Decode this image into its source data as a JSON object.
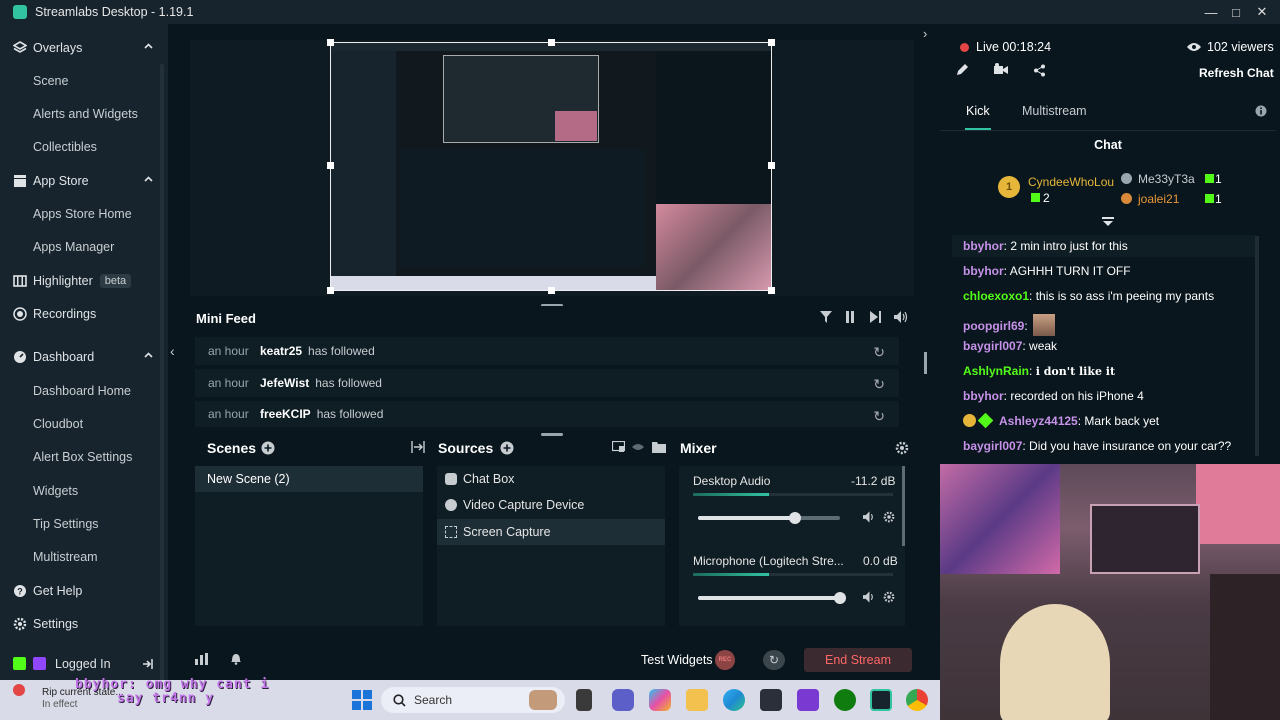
{
  "window": {
    "title": "Streamlabs Desktop - 1.19.1"
  },
  "sidebar": {
    "overlays": "Overlays",
    "scene": "Scene",
    "alerts_widgets": "Alerts and Widgets",
    "collectibles": "Collectibles",
    "app_store": "App Store",
    "apps_store_home": "Apps Store Home",
    "apps_manager": "Apps Manager",
    "highlighter": "Highlighter",
    "highlighter_badge": "beta",
    "recordings": "Recordings",
    "dashboard": "Dashboard",
    "dashboard_home": "Dashboard Home",
    "cloudbot": "Cloudbot",
    "alert_box_settings": "Alert Box Settings",
    "widgets": "Widgets",
    "tip_settings": "Tip Settings",
    "multistream": "Multistream",
    "get_help": "Get Help",
    "settings": "Settings",
    "logged_in": "Logged In"
  },
  "minifeed": {
    "title": "Mini Feed",
    "rows": [
      {
        "time": "an hour",
        "user": "keatr25",
        "action": "has followed"
      },
      {
        "time": "an hour",
        "user": "JefeWist",
        "action": "has followed"
      },
      {
        "time": "an hour",
        "user": "freeKCIP",
        "action": "has followed"
      }
    ]
  },
  "scenes": {
    "title": "Scenes",
    "items": [
      "New Scene (2)"
    ]
  },
  "sources": {
    "title": "Sources",
    "items": [
      "Chat Box",
      "Video Capture Device",
      "Screen Capture"
    ]
  },
  "mixer": {
    "title": "Mixer",
    "channels": [
      {
        "name": "Desktop Audio",
        "value": "-11.2 dB",
        "level": 0.68
      },
      {
        "name": "Microphone (Logitech Stre...",
        "value": "0.0 dB",
        "level": 1.0
      }
    ]
  },
  "footer": {
    "test_widgets": "Test Widgets",
    "rec": "REC",
    "end_stream": "End Stream"
  },
  "live": {
    "status": "Live",
    "time": "00:18:24",
    "viewers": "102 viewers",
    "refresh": "Refresh Chat"
  },
  "chat": {
    "tabs": [
      "Kick",
      "Multistream"
    ],
    "title": "Chat",
    "gifters": [
      {
        "name": "CyndeeWhoLou",
        "count": "2"
      },
      {
        "name": "Me33yT3a",
        "count": "1"
      },
      {
        "name": "joalei21",
        "count": "1"
      }
    ],
    "messages": [
      {
        "user": "bbyhor",
        "text": "2 min intro just for this",
        "color": "#c792ea"
      },
      {
        "user": "bbyhor",
        "text": "AGHHH TURN IT OFF",
        "color": "#c792ea"
      },
      {
        "user": "chloexoxo1",
        "text": "this is so ass i'm peeing my pants",
        "color": "#53fc18"
      },
      {
        "user": "poopgirl69",
        "text": "",
        "color": "#c792ea"
      },
      {
        "user": "baygirl007",
        "text": "weak",
        "color": "#c792ea"
      },
      {
        "user": "AshlynRain",
        "text": "i don't like it",
        "color": "#53fc18"
      },
      {
        "user": "bbyhor",
        "text": "recorded on his iPhone 4",
        "color": "#c792ea"
      },
      {
        "user": "Ashleyz44125",
        "text": "Mark back yet",
        "color": "#c792ea"
      },
      {
        "user": "baygirl007",
        "text": "Did you have insurance on your car??",
        "color": "#c792ea"
      }
    ]
  },
  "taskbar": {
    "search": "Search",
    "notification": "Rip current state...",
    "notification_sub": "In effect",
    "overlay_line1": "bbyhor: omg why cant i",
    "overlay_line2": "say tr4nn y"
  }
}
